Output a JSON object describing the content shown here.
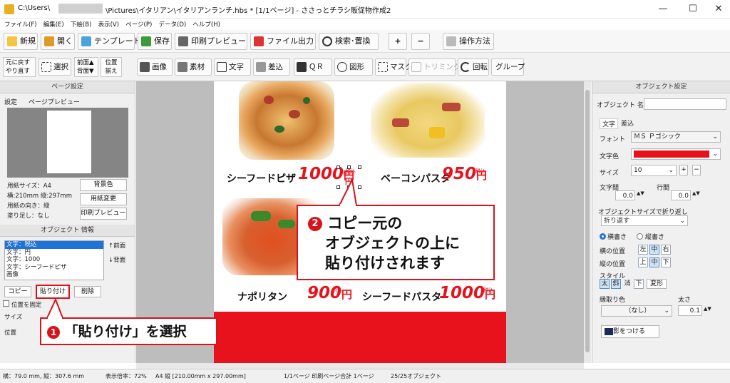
{
  "titlebar": {
    "prefix": "C:\\Users\\",
    "path": "\\Pictures\\イタリアン\\イタリアンランチ.hbs *  [1/1ページ] - ささっとチラシ販促物作成2",
    "min": "—",
    "max": "☐",
    "close": "✕"
  },
  "menu": [
    "ファイル(F)",
    "編集(E)",
    "下絵(B)",
    "表示(V)",
    "ページ(P)",
    "データ(D)",
    "ヘルプ(H)"
  ],
  "toolbar1": {
    "new": "新規",
    "open": "開く",
    "template": "テンプレート",
    "save": "保存",
    "print_preview": "印刷プレビュー",
    "file_output": "ファイル出力",
    "search_replace": "検索･置換",
    "zoom_in": "+",
    "zoom_out": "−",
    "howto": "操作方法"
  },
  "toolbar2": {
    "undo": "元に戻す",
    "redo": "やり直す",
    "select": "選択",
    "front": "前面▲",
    "back": "背面▼",
    "pos1": "位置",
    "pos2": "揃え",
    "image": "画像",
    "material": "素材",
    "text": "文字",
    "insert": "差込",
    "qr": "ＱＲ",
    "shape": "図形",
    "mask": "マスク",
    "trim": "トリミング",
    "rotate": "回転",
    "group": "グループ"
  },
  "page_settings": {
    "header": "ページ設定",
    "tab_settings": "設定",
    "tab_preview": "ページプレビュー",
    "paper_size": "用紙サイズ：A4",
    "dims": "横:210mm 縦:297mm",
    "orientation": "用紙の向き：縦",
    "bleed": "塗り足し：なし",
    "bg_color": "背景色",
    "paper_change": "用紙変更",
    "print_preview": "印刷プレビュー"
  },
  "object_info": {
    "header": "オブジェクト 情報",
    "items": [
      "文字：税込",
      "文字：円",
      "文字：1000",
      "文字：シーフードピザ",
      "画像"
    ],
    "front": "↑前面",
    "back": "↓背面",
    "copy": "コピー",
    "paste": "貼り付け",
    "delete": "削除",
    "fix_pos": "位置を固定",
    "size": "サイズ",
    "position": "位置"
  },
  "flyer": {
    "item1_name": "シーフードピザ",
    "item1_price": "1000",
    "item1_tax": "税込",
    "item2_name": "ベーコンパスタ",
    "item2_price": "950",
    "item2_tax": "税込",
    "item3_name": "ナポリタン",
    "item3_price": "900",
    "item3_tax": "税込",
    "item4_name": "シーフードパスタ",
    "item4_price": "1000",
    "item4_tax": "税込",
    "yen": "円",
    "selected_tax": "税込",
    "selected_yen": "円"
  },
  "callout1": {
    "num": "1",
    "text": "「貼り付け」を選択"
  },
  "callout2": {
    "num": "2",
    "line1": "コピー元の",
    "line2": "オブジェクトの上に",
    "line3": "貼り付けされます"
  },
  "object_settings": {
    "header": "オブジェクト設定",
    "name_label": "オブジェクト 名",
    "tab_text": "文字",
    "tab_insert": "差込",
    "font_label": "フォント",
    "font_value": "ＭＳ Ｐゴシック",
    "color_label": "文字色",
    "color_value": "#e8121c",
    "size_label": "サイズ",
    "size_value": "10",
    "char_spacing": "文字間",
    "char_spacing_value": "0.0",
    "line_spacing": "行間",
    "line_spacing_value": "0.0",
    "wrap_label": "オブジェクトサイズで折り返し",
    "wrap_value": "折り返す",
    "horizontal": "横書き",
    "vertical": "縦書き",
    "h_pos": "横の位置",
    "h_left": "左",
    "h_center": "中",
    "h_right": "右",
    "v_pos": "縦の位置",
    "v_top": "上",
    "v_middle": "中",
    "v_bottom": "下",
    "style_label": "スタイル",
    "bold": "太",
    "italic": "斜",
    "strike": "消",
    "underline": "下",
    "transform": "変形",
    "outline_label": "縁取り色",
    "outline_value": "（なし）",
    "thickness_label": "太さ",
    "thickness_value": "0.1",
    "shadow": "影をつける"
  },
  "status": {
    "cursor": "横：79.0 mm, 縦：307.6 mm",
    "zoom": "表示倍率：72%",
    "paper": "A4 縦 [210.00mm x 297.00mm]",
    "pages": "1/1ページ 印刷ページ合計 1ページ",
    "objects": "25/25オブジェクト"
  }
}
